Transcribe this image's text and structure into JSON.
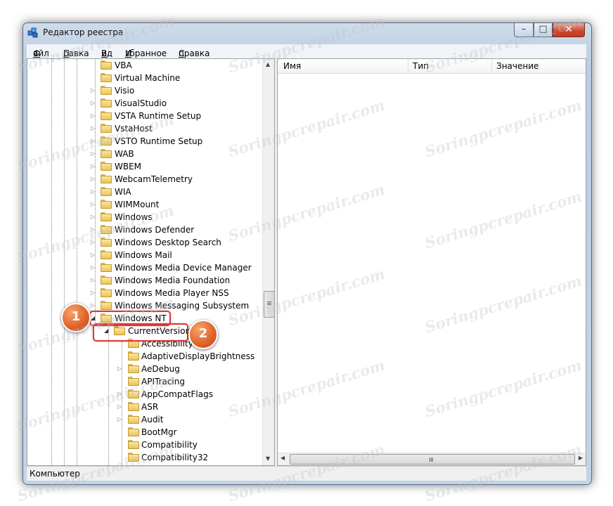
{
  "window": {
    "title": "Редактор реестра",
    "controls": {
      "minimize": "–",
      "maximize": "□",
      "close": "✕"
    }
  },
  "menu": [
    {
      "label": "Файл",
      "accel": "Ф",
      "rest": "айл"
    },
    {
      "label": "Правка",
      "accel": "П",
      "rest": "равка"
    },
    {
      "label": "Вид",
      "accel": "В",
      "rest": "ид"
    },
    {
      "label": "Избранное",
      "accel": "И",
      "rest": "збранное"
    },
    {
      "label": "Справка",
      "accel": "С",
      "rest": "правка"
    }
  ],
  "tree": {
    "items": [
      {
        "label": "VBA",
        "depth": 0,
        "expander": ""
      },
      {
        "label": "Virtual Machine",
        "depth": 0,
        "expander": ""
      },
      {
        "label": "Visio",
        "depth": 0,
        "expander": "▷"
      },
      {
        "label": "VisualStudio",
        "depth": 0,
        "expander": "▷"
      },
      {
        "label": "VSTA Runtime Setup",
        "depth": 0,
        "expander": "▷"
      },
      {
        "label": "VstaHost",
        "depth": 0,
        "expander": "▷"
      },
      {
        "label": "VSTO Runtime Setup",
        "depth": 0,
        "expander": "▷"
      },
      {
        "label": "WAB",
        "depth": 0,
        "expander": "▷"
      },
      {
        "label": "WBEM",
        "depth": 0,
        "expander": "▷"
      },
      {
        "label": "WebcamTelemetry",
        "depth": 0,
        "expander": "▷"
      },
      {
        "label": "WIA",
        "depth": 0,
        "expander": "▷"
      },
      {
        "label": "WIMMount",
        "depth": 0,
        "expander": "▷"
      },
      {
        "label": "Windows",
        "depth": 0,
        "expander": "▷"
      },
      {
        "label": "Windows Defender",
        "depth": 0,
        "expander": "▷"
      },
      {
        "label": "Windows Desktop Search",
        "depth": 0,
        "expander": "▷"
      },
      {
        "label": "Windows Mail",
        "depth": 0,
        "expander": "▷"
      },
      {
        "label": "Windows Media Device Manager",
        "depth": 0,
        "expander": "▷"
      },
      {
        "label": "Windows Media Foundation",
        "depth": 0,
        "expander": "▷"
      },
      {
        "label": "Windows Media Player NSS",
        "depth": 0,
        "expander": "▷"
      },
      {
        "label": "Windows Messaging Subsystem",
        "depth": 0,
        "expander": "▷"
      },
      {
        "label": "Windows NT",
        "depth": 0,
        "expander": "◢"
      },
      {
        "label": "CurrentVersion",
        "depth": 1,
        "expander": "◢"
      },
      {
        "label": "Accessibility",
        "depth": 2,
        "expander": ""
      },
      {
        "label": "AdaptiveDisplayBrightness",
        "depth": 2,
        "expander": ""
      },
      {
        "label": "AeDebug",
        "depth": 2,
        "expander": "▷"
      },
      {
        "label": "APITracing",
        "depth": 2,
        "expander": ""
      },
      {
        "label": "AppCompatFlags",
        "depth": 2,
        "expander": "▷"
      },
      {
        "label": "ASR",
        "depth": 2,
        "expander": "▷"
      },
      {
        "label": "Audit",
        "depth": 2,
        "expander": "▷"
      },
      {
        "label": "BootMgr",
        "depth": 2,
        "expander": ""
      },
      {
        "label": "Compatibility",
        "depth": 2,
        "expander": ""
      },
      {
        "label": "Compatibility32",
        "depth": 2,
        "expander": ""
      }
    ]
  },
  "callouts": [
    {
      "number": "1",
      "target": "Windows NT"
    },
    {
      "number": "2",
      "target": "CurrentVersion"
    }
  ],
  "list": {
    "columns": [
      "Имя",
      "Тип",
      "Значение"
    ]
  },
  "status": "Компьютер",
  "watermark": "Soringpcrepair.com",
  "colors": {
    "callout": "#e2672c",
    "highlight": "#d73b3b",
    "folder": "#f3d27a"
  }
}
